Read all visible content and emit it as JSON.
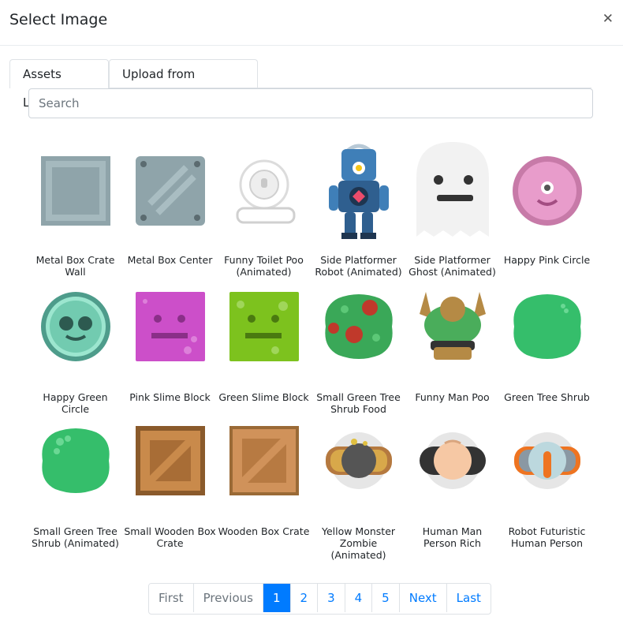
{
  "modal": {
    "title": "Select Image"
  },
  "tabs": [
    {
      "label": "Assets Library",
      "active": true
    },
    {
      "label": "Upload from computer",
      "active": false
    }
  ],
  "search": {
    "placeholder": "Search",
    "value": ""
  },
  "assets": [
    {
      "label": "Metal Box Crate Wall",
      "icon": "metal-box-crate-wall"
    },
    {
      "label": "Metal Box Center",
      "icon": "metal-box-center"
    },
    {
      "label": "Funny Toilet Poo (Animated)",
      "icon": "funny-toilet-poo"
    },
    {
      "label": "Side Platformer Robot (Animated)",
      "icon": "side-platformer-robot"
    },
    {
      "label": "Side Platformer Ghost (Animated)",
      "icon": "side-platformer-ghost"
    },
    {
      "label": "Happy Pink Circle",
      "icon": "happy-pink-circle"
    },
    {
      "label": "Happy Green Circle",
      "icon": "happy-green-circle"
    },
    {
      "label": "Pink Slime Block",
      "icon": "pink-slime-block"
    },
    {
      "label": "Green Slime Block",
      "icon": "green-slime-block"
    },
    {
      "label": "Small Green Tree Shrub Food",
      "icon": "small-green-tree-shrub-food"
    },
    {
      "label": "Funny Man Poo",
      "icon": "funny-man-poo"
    },
    {
      "label": "Green Tree Shrub",
      "icon": "green-tree-shrub"
    },
    {
      "label": "Small Green Tree Shrub (Animated)",
      "icon": "small-green-tree-shrub"
    },
    {
      "label": "Small Wooden Box Crate",
      "icon": "small-wooden-box-crate"
    },
    {
      "label": "Wooden Box Crate",
      "icon": "wooden-box-crate"
    },
    {
      "label": "Yellow Monster Zombie (Animated)",
      "icon": "yellow-monster-zombie"
    },
    {
      "label": "Human Man Person Rich",
      "icon": "human-man-person-rich"
    },
    {
      "label": "Robot Futuristic Human Person",
      "icon": "robot-futuristic-human-person"
    }
  ],
  "pagination": {
    "first": "First",
    "previous": "Previous",
    "pages": [
      "1",
      "2",
      "3",
      "4",
      "5"
    ],
    "active_page": "1",
    "next": "Next",
    "last": "Last"
  },
  "colors": {
    "accent": "#007bff"
  }
}
